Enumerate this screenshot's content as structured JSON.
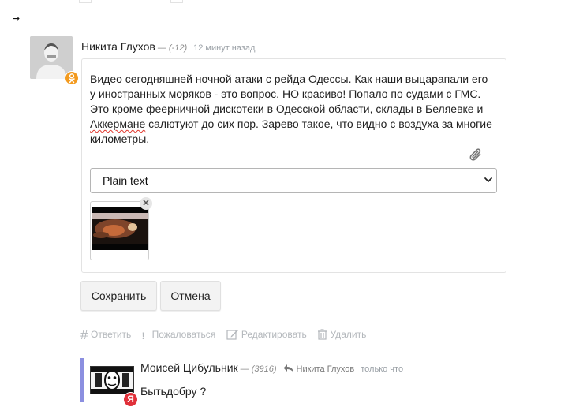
{
  "comment": {
    "author": "Никита Глухов",
    "rating": "— (-12)",
    "time": "12 минут назад",
    "badge_icon": "odnoklassniki-icon",
    "badge_color": "#f39a1e"
  },
  "editor": {
    "text": "Видео сегодняшней ночной атаки с рейда Одессы.  Как наши выцарапали его у иностранных моряков - это вопрос.  НО красиво! Попало по судами с ГМС. Это кроме феерничной дискотеки в Одесской области, склады в Беляевке и ",
    "text_misspelled": "Аккермане",
    "text_tail": " салютуют до сих пор. Зарево такое, что видно с воздуха за многие километры.",
    "format_selected": "Plain text",
    "attach_icon": "paperclip-icon",
    "remove_attachment": "✕"
  },
  "buttons": {
    "save": "Сохранить",
    "cancel": "Отмена"
  },
  "actions": {
    "reply": "Ответить",
    "report": "Пожаловаться",
    "edit": "Редактировать",
    "delete": "Удалить"
  },
  "reply_comment": {
    "author": "Моисей Цибульник",
    "rating": "— (3916)",
    "reply_to": "Никита Глухов",
    "time": "только что",
    "text": "Бытьдобру ?",
    "badge_letter": "Я",
    "badge_color": "#e0303a",
    "thread_color": "#8b8fe0"
  }
}
